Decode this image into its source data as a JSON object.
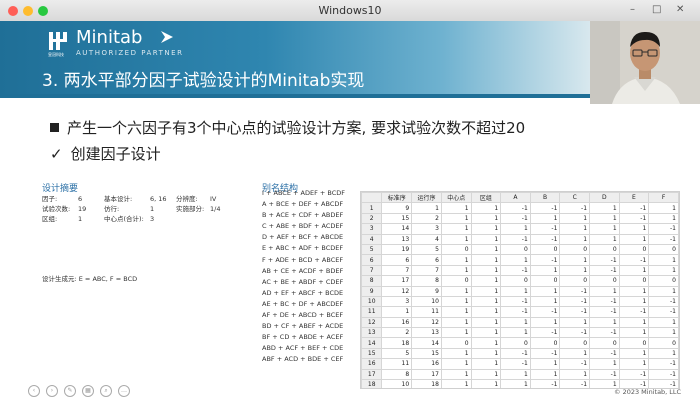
{
  "window": {
    "title": "Windows10",
    "controls": {
      "minimize": "–",
      "maximize": "□",
      "close": "✕"
    }
  },
  "logo": {
    "brand": "Minitab",
    "partner": "AUTHORIZED PARTNER",
    "sub": "皇冠科技"
  },
  "slide": {
    "title": "3. 两水平部分因子试验设计的Minitab实现",
    "bullet1": "产生一个六因子有3个中心点的试验设计方案, 要求试验次数不超过20",
    "bullet2_mark": "✓",
    "bullet2": "创建因子设计"
  },
  "design_summary": {
    "heading": "设计摘要",
    "rows": [
      {
        "k1": "因子:",
        "v1": "6",
        "k2": "基本设计:",
        "v2": "6, 16",
        "k3": "分辨度:",
        "v3": "IV"
      },
      {
        "k1": "试验次数:",
        "v1": "19",
        "k2": "仿行:",
        "v2": "1",
        "k3": "实施部分:",
        "v3": "1/4"
      },
      {
        "k1": "区组:",
        "v1": "1",
        "k2": "中心点(合计):",
        "v2": "3",
        "k3": "",
        "v3": ""
      }
    ],
    "generators": "设计生成元: E = ABC, F = BCD"
  },
  "alias": {
    "heading": "别名结构",
    "lines": [
      "I + ABCE + ADEF + BCDF",
      "A + BCE + DEF + ABCDF",
      "B + ACE + CDF + ABDEF",
      "C + ABE + BDF + ACDEF",
      "D + AEF + BCF + ABCDE",
      "E + ABC + ADF + BCDEF",
      "F + ADE + BCD + ABCEF",
      "AB + CE + ACDF + BDEF",
      "AC + BE + ABDF + CDEF",
      "AD + EF + ABCF + BCDE",
      "AE + BC + DF + ABCDEF",
      "AF + DE + ABCD + BCEF",
      "BD + CF + ABEF + ACDE",
      "BF + CD + ABDE + ACEF",
      "ABD + ACF + BEF + CDE",
      "ABF + ACD + BDE + CEF"
    ]
  },
  "sheet": {
    "headers": [
      "",
      "标准序",
      "运行序",
      "中心点",
      "区组",
      "A",
      "B",
      "C",
      "D",
      "E",
      "F"
    ],
    "rows": [
      [
        "9",
        "1",
        "1",
        "1",
        "-1",
        "-1",
        "-1",
        "1",
        "-1",
        "1"
      ],
      [
        "15",
        "2",
        "1",
        "1",
        "-1",
        "1",
        "1",
        "1",
        "-1",
        "1"
      ],
      [
        "14",
        "3",
        "1",
        "1",
        "1",
        "-1",
        "1",
        "1",
        "1",
        "-1"
      ],
      [
        "13",
        "4",
        "1",
        "1",
        "-1",
        "-1",
        "1",
        "1",
        "1",
        "-1"
      ],
      [
        "19",
        "5",
        "0",
        "1",
        "0",
        "0",
        "0",
        "0",
        "0",
        "0"
      ],
      [
        "6",
        "6",
        "1",
        "1",
        "1",
        "-1",
        "1",
        "-1",
        "-1",
        "1"
      ],
      [
        "7",
        "7",
        "1",
        "1",
        "-1",
        "1",
        "1",
        "-1",
        "1",
        "1"
      ],
      [
        "17",
        "8",
        "0",
        "1",
        "0",
        "0",
        "0",
        "0",
        "0",
        "0"
      ],
      [
        "12",
        "9",
        "1",
        "1",
        "1",
        "1",
        "-1",
        "1",
        "1",
        "1"
      ],
      [
        "3",
        "10",
        "1",
        "1",
        "-1",
        "1",
        "-1",
        "-1",
        "1",
        "-1"
      ],
      [
        "1",
        "11",
        "1",
        "1",
        "-1",
        "-1",
        "-1",
        "-1",
        "-1",
        "-1"
      ],
      [
        "16",
        "12",
        "1",
        "1",
        "1",
        "1",
        "1",
        "1",
        "1",
        "1"
      ],
      [
        "2",
        "13",
        "1",
        "1",
        "1",
        "-1",
        "-1",
        "-1",
        "1",
        "1"
      ],
      [
        "18",
        "14",
        "0",
        "1",
        "0",
        "0",
        "0",
        "0",
        "0",
        "0"
      ],
      [
        "5",
        "15",
        "1",
        "1",
        "-1",
        "-1",
        "1",
        "-1",
        "1",
        "1"
      ],
      [
        "11",
        "16",
        "1",
        "1",
        "-1",
        "1",
        "-1",
        "1",
        "1",
        "-1"
      ],
      [
        "8",
        "17",
        "1",
        "1",
        "1",
        "1",
        "1",
        "-1",
        "-1",
        "-1"
      ],
      [
        "10",
        "18",
        "1",
        "1",
        "1",
        "-1",
        "-1",
        "1",
        "-1",
        "-1"
      ],
      [
        "4",
        "19",
        "1",
        "1",
        "1",
        "1",
        "-1",
        "-1",
        "-1",
        "1"
      ]
    ]
  },
  "copyright": "© 2023 Minitab, LLC",
  "colors": {
    "accent": "#1f6f97",
    "heading_blue": "#2a6fa6"
  }
}
